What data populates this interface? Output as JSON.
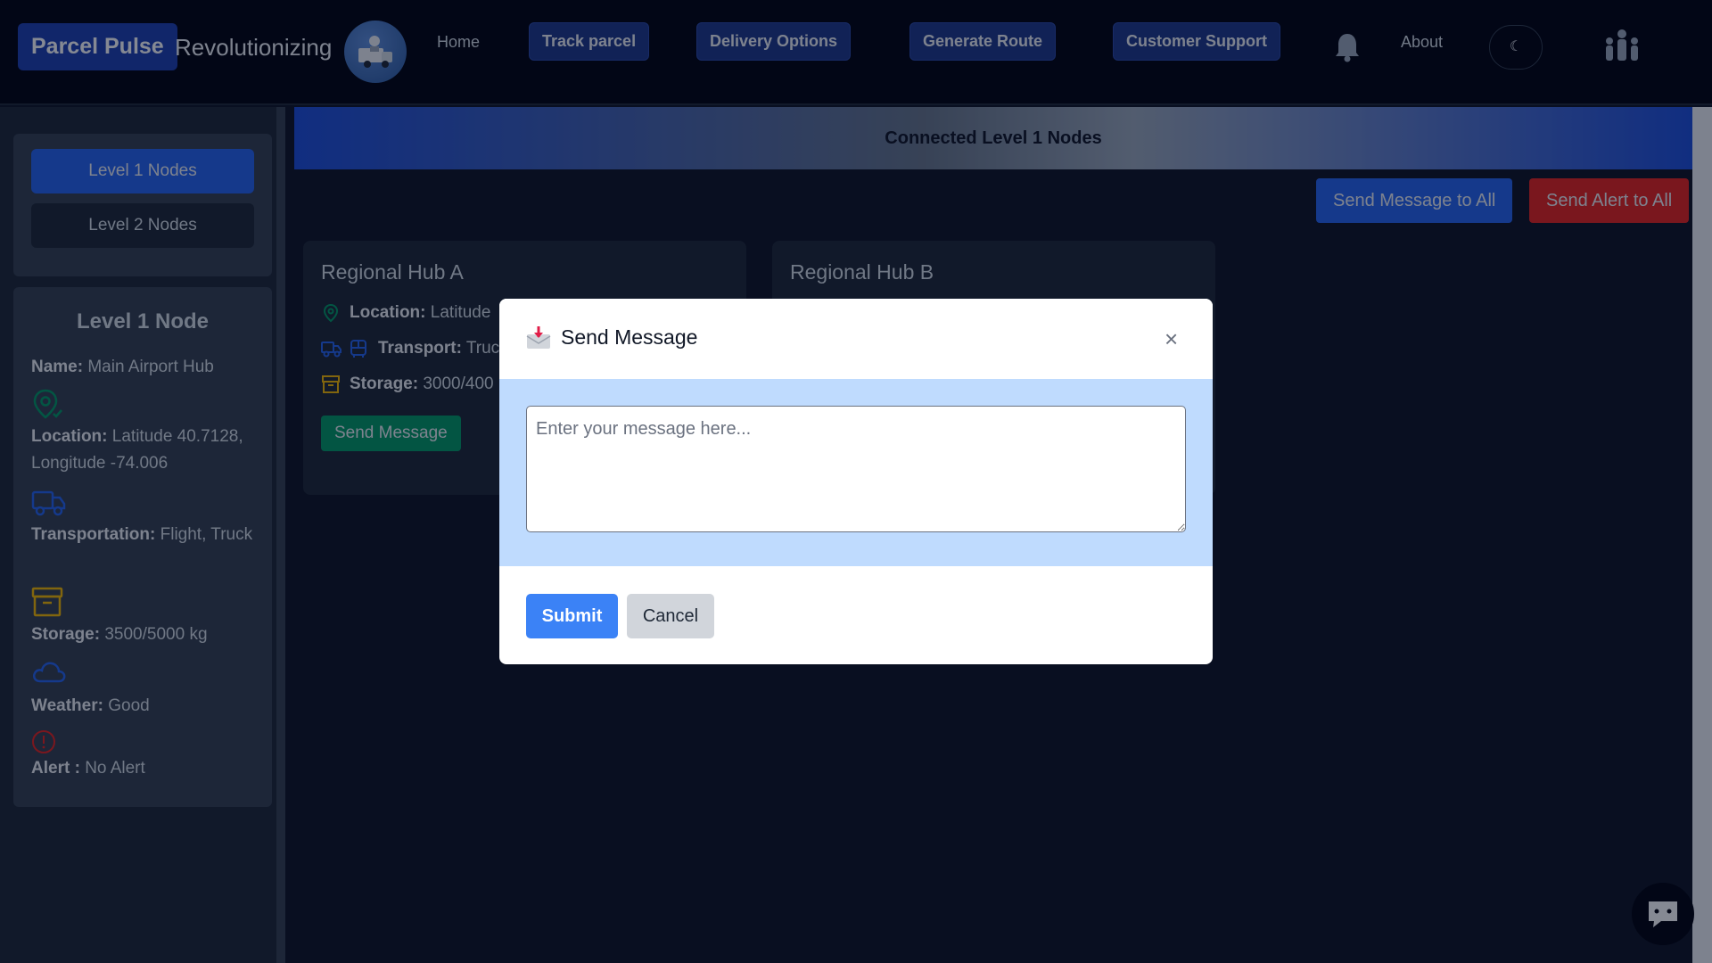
{
  "navbar": {
    "brand": "Parcel Pulse",
    "tagline": "Revolutionizing",
    "home": "Home",
    "track": "Track parcel",
    "delivery": "Delivery Options",
    "route": "Generate Route",
    "support": "Customer Support",
    "about": "About",
    "theme_icon": "☾"
  },
  "sidebar": {
    "level1": "Level 1 Nodes",
    "level2": "Level 2 Nodes",
    "node": {
      "title": "Level 1 Node",
      "name_label": "Name:",
      "name": "Main Airport Hub",
      "location_label": "Location:",
      "location": "Latitude 40.7128, Longitude -74.006",
      "transport_label": "Transportation:",
      "transport": "Flight, Truck",
      "storage_label": "Storage:",
      "storage": "3500/5000 kg",
      "weather_label": "Weather:",
      "weather": "Good",
      "alert_label": "Alert :",
      "alert": "No Alert"
    }
  },
  "main": {
    "header": "Connected Level 1 Nodes",
    "send_all": "Send Message to All",
    "alert_all": "Send Alert to All",
    "hubs": [
      {
        "title": "Regional Hub A",
        "location_label": "Location:",
        "location": "Latitude",
        "transport_label": "Transport:",
        "transport": "Truc",
        "storage_label": "Storage:",
        "storage": "3000/400",
        "send": "Send Message"
      },
      {
        "title": "Regional Hub B"
      }
    ]
  },
  "modal": {
    "title": "Send Message",
    "close": "×",
    "placeholder": "Enter your message here...",
    "submit": "Submit",
    "cancel": "Cancel"
  },
  "colors": {
    "navbar_bg": "#020617",
    "page_bg": "#0f172a",
    "primary": "#2563eb",
    "danger": "#dc2626",
    "success": "#059669",
    "modal_body": "#bfdbfe"
  },
  "icons": [
    "logo-delivery-icon",
    "bell-icon",
    "moon-icon",
    "user-network-icon",
    "location-pin-icon",
    "truck-icon",
    "bus-icon",
    "archive-box-icon",
    "cloud-icon",
    "alert-circle-icon",
    "mail-inbox-icon",
    "close-icon",
    "chat-icon"
  ]
}
